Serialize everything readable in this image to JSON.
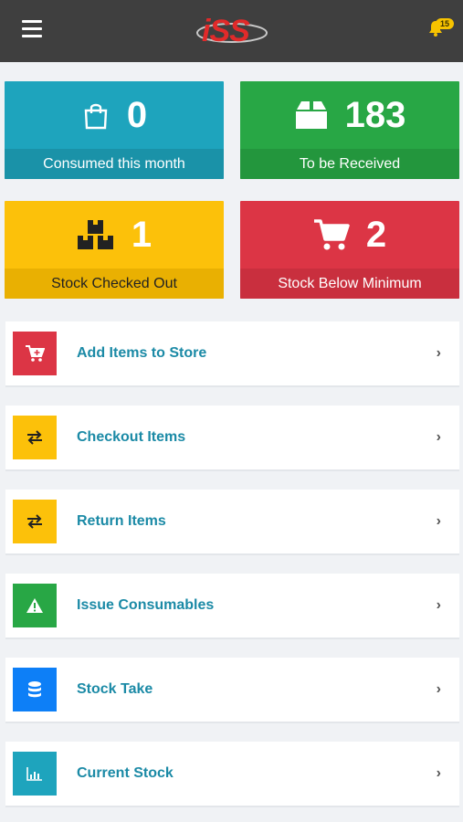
{
  "header": {
    "logo_text": "iSS",
    "notification_count": "15"
  },
  "tiles": [
    {
      "value": "0",
      "label": "Consumed this month",
      "icon": "shopping-bag-icon",
      "color": "#1ea4bd"
    },
    {
      "value": "183",
      "label": "To be Received",
      "icon": "package-icon",
      "color": "#28a745"
    },
    {
      "value": "1",
      "label": "Stock Checked Out",
      "icon": "boxes-icon",
      "color": "#fcc10a"
    },
    {
      "value": "2",
      "label": "Stock Below Minimum",
      "icon": "cart-icon",
      "color": "#dc3545"
    }
  ],
  "menu": [
    {
      "label": "Add Items to Store",
      "icon": "cart-plus-icon",
      "color": "#dc3545"
    },
    {
      "label": "Checkout Items",
      "icon": "exchange-icon",
      "color": "#fcc10a"
    },
    {
      "label": "Return Items",
      "icon": "exchange-icon",
      "color": "#fcc10a"
    },
    {
      "label": "Issue Consumables",
      "icon": "warning-icon",
      "color": "#28a745"
    },
    {
      "label": "Stock Take",
      "icon": "database-icon",
      "color": "#0d7ff7"
    },
    {
      "label": "Current Stock",
      "icon": "bar-chart-icon",
      "color": "#1ea4bd"
    }
  ]
}
